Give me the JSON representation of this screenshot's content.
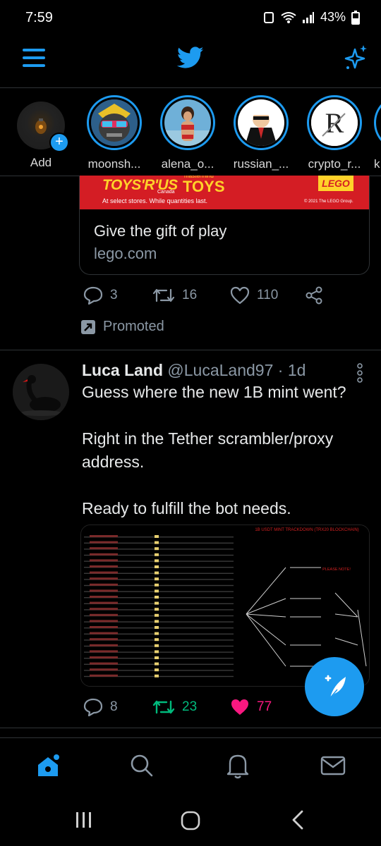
{
  "status_bar": {
    "time": "7:59",
    "battery": "43%"
  },
  "header": {
    "logo": "twitter-bird-icon",
    "menu_icon": "menu-icon",
    "sparkle_icon": "sparkle-icon"
  },
  "fleets": [
    {
      "label": "Add"
    },
    {
      "label": "moonsh..."
    },
    {
      "label": "alena_o..."
    },
    {
      "label": "russian_..."
    },
    {
      "label": "crypto_r..."
    },
    {
      "label": "k"
    }
  ],
  "promo": {
    "banner_brand1": "TOYS'R'US",
    "banner_brand1_sub": "Canada",
    "banner_brand2_top": "mastermind",
    "banner_brand2": "TOYS",
    "banner_brand3": "LEGO",
    "banner_line": "At select stores. While quantities last.",
    "banner_copy": "© 2021 The LEGO Group.",
    "card_title": "Give the gift of play",
    "card_url": "lego.com",
    "reply_count": "3",
    "retweet_count": "16",
    "like_count": "110",
    "promoted_label": "Promoted"
  },
  "tweet": {
    "name": "Luca Land",
    "handle": "@LucaLand97",
    "time": "· 1d",
    "lines": [
      "Guess where the new 1B mint went?",
      "",
      "Right in the Tether scrambler/proxy address.",
      "",
      "Ready to fulfill the bot needs."
    ],
    "media": {
      "right_title": "1B USDT MINT TRACKDOWN (TRX20 BLOCKCHAIN)",
      "please_note": "PLEASE NOTE!"
    },
    "reply_count": "8",
    "retweet_count": "23",
    "like_count": "77"
  },
  "colors": {
    "accent": "#1d9bf0",
    "retweet": "#00ba7c",
    "like": "#f91880",
    "muted": "#8b98a5"
  }
}
